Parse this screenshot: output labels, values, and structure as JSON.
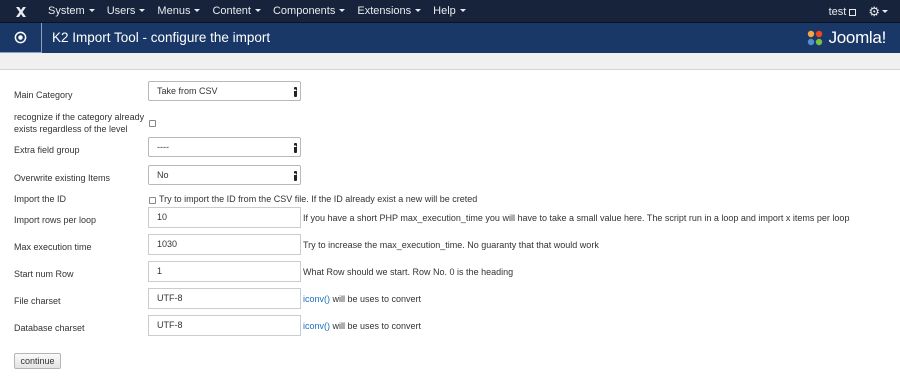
{
  "navbar": {
    "logo_icon": "joomla-logo-icon",
    "menu": [
      {
        "label": "System"
      },
      {
        "label": "Users"
      },
      {
        "label": "Menus"
      },
      {
        "label": "Content"
      },
      {
        "label": "Components"
      },
      {
        "label": "Extensions"
      },
      {
        "label": "Help"
      }
    ],
    "user": "test",
    "user_icon": "external-link-icon",
    "settings_icon": "gear-icon"
  },
  "header": {
    "icon": "circle-dot-icon",
    "title": "K2 Import Tool - configure the import",
    "brand": "Joomla!"
  },
  "form": {
    "main_category": {
      "label": "Main Category",
      "value": "Take from CSV"
    },
    "recognize_category": {
      "label_line1": "recognize if the category already",
      "label_line2": "exists regardless of the level",
      "checked": false
    },
    "extra_field_group": {
      "label": "Extra field group",
      "value": "----"
    },
    "overwrite_items": {
      "label": "Overwrite existing Items",
      "value": "No"
    },
    "import_id": {
      "label": "Import the ID",
      "checked": false,
      "help": "Try to import the ID from the CSV file. If the ID already exist a new will be creted"
    },
    "import_rows": {
      "label": "Import rows per loop",
      "value": "10",
      "help": "If you have a short PHP max_execution_time you will have to take a small value here. The script run in a loop and import x items per loop"
    },
    "max_execution": {
      "label": "Max execution time",
      "value": "1030",
      "help": "Try to increase the max_execution_time. No guaranty that that would work"
    },
    "start_row": {
      "label": "Start num Row",
      "value": "1",
      "help": "What Row should we start. Row No. 0 is the heading"
    },
    "file_charset": {
      "label": "File charset",
      "value": "UTF-8",
      "help_link": "iconv()",
      "help_text": " will be uses to convert"
    },
    "db_charset": {
      "label": "Database charset",
      "value": "UTF-8",
      "help_link": "iconv()",
      "help_text": " will be uses to convert"
    },
    "continue_label": "continue"
  },
  "colors": {
    "navbar": "#17233a",
    "header": "#1a3867",
    "link": "#1b6fbf"
  }
}
